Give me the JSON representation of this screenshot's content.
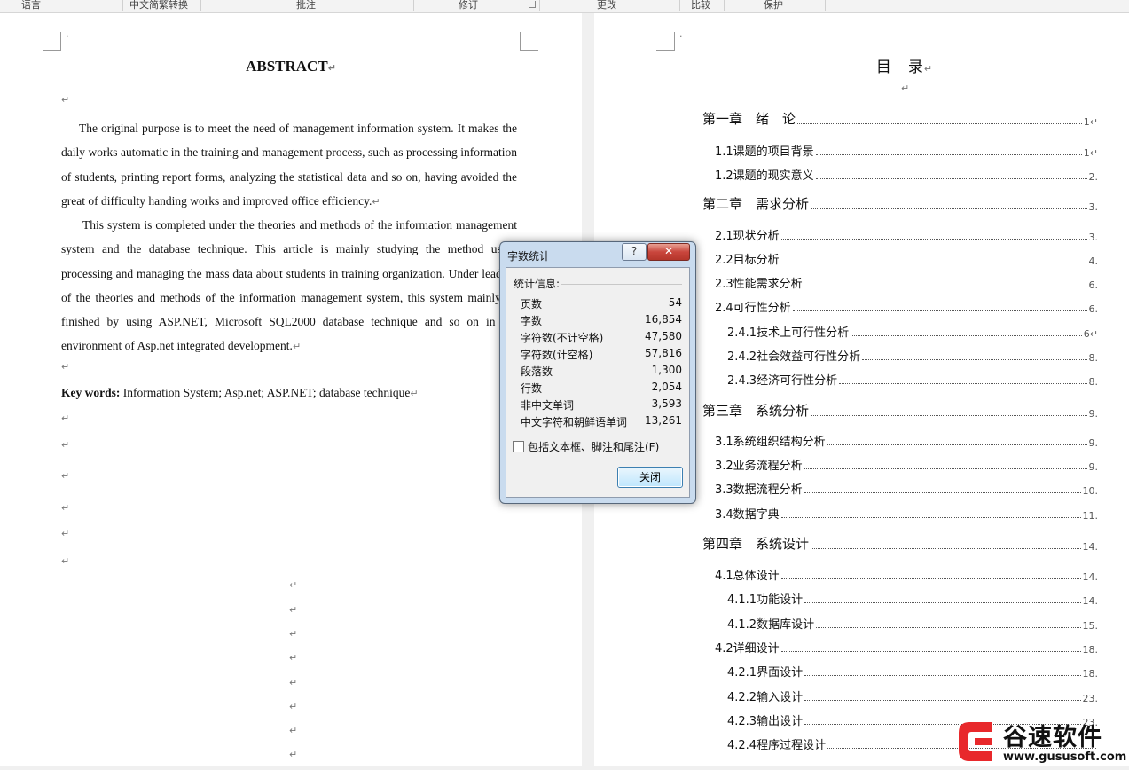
{
  "ribbon": {
    "groups": [
      "语言",
      "中文简繁转换",
      "批注",
      "修订",
      "更改",
      "比较",
      "保护"
    ]
  },
  "left_page": {
    "title": "ABSTRACT",
    "para1": "The original purpose is to meet the need of management information system. It makes the daily works automatic in the training and management process, such as processing information of students, printing report forms, analyzing the statistical data and so on, having avoided the great of difficulty handing works and improved office efficiency.",
    "para2": "This system is completed under the theories and methods of the information management system and the database technique. This article is mainly studying the method using processing and managing the mass data about students in training organization. Under leading of the theories and methods of the information management system, this system mainly be finished by using ASP.NET, Microsoft SQL2000 database technique and so on in the environment of Asp.net integrated development.",
    "keywords_label": "Key words:",
    "keywords_text": " Information System; Asp.net; ASP.NET; database technique",
    "para_mark": "↵",
    "top_mark": "·"
  },
  "right_page": {
    "title": "目　录",
    "para_mark": "↵",
    "top_mark": "·",
    "toc": [
      {
        "label": "第一章　绪　论",
        "page": "1↵"
      },
      {
        "label": "1.1课题的项目背景",
        "page": "1↵"
      },
      {
        "label": "1.2课题的现实意义",
        "page": "2."
      },
      {
        "label": "第二章　需求分析",
        "page": "3."
      },
      {
        "label": "2.1现状分析",
        "page": "3."
      },
      {
        "label": "2.2目标分析",
        "page": "4."
      },
      {
        "label": "2.3性能需求分析",
        "page": "6."
      },
      {
        "label": "2.4可行性分析",
        "page": "6."
      },
      {
        "label": "2.4.1技术上可行性分析",
        "page": "6↵"
      },
      {
        "label": "2.4.2社会效益可行性分析",
        "page": "8."
      },
      {
        "label": "2.4.3经济可行性分析",
        "page": "8."
      },
      {
        "label": "第三章　系统分析",
        "page": "9."
      },
      {
        "label": "3.1系统组织结构分析",
        "page": "9."
      },
      {
        "label": "3.2业务流程分析",
        "page": "9."
      },
      {
        "label": "3.3数据流程分析",
        "page": "10."
      },
      {
        "label": "3.4数据字典",
        "page": "11."
      },
      {
        "label": "第四章　系统设计",
        "page": "14."
      },
      {
        "label": "4.1总体设计",
        "page": "14."
      },
      {
        "label": "4.1.1功能设计",
        "page": "14."
      },
      {
        "label": "4.1.2数据库设计",
        "page": "15."
      },
      {
        "label": "4.2详细设计",
        "page": "18."
      },
      {
        "label": "4.2.1界面设计",
        "page": "18."
      },
      {
        "label": "4.2.2输入设计",
        "page": "23."
      },
      {
        "label": "4.2.3输出设计",
        "page": "23."
      },
      {
        "label": "4.2.4程序过程设计",
        "page": ""
      }
    ]
  },
  "dialog": {
    "title": "字数统计",
    "help": "?",
    "section": "统计信息:",
    "stats": [
      {
        "label": "页数",
        "value": "54"
      },
      {
        "label": "字数",
        "value": "16,854"
      },
      {
        "label": "字符数(不计空格)",
        "value": "47,580"
      },
      {
        "label": "字符数(计空格)",
        "value": "57,816"
      },
      {
        "label": "段落数",
        "value": "1,300"
      },
      {
        "label": "行数",
        "value": "2,054"
      },
      {
        "label": "非中文单词",
        "value": "3,593"
      },
      {
        "label": "中文字符和朝鲜语单词",
        "value": "13,261"
      }
    ],
    "checkbox_label": "包括文本框、脚注和尾注(F)",
    "close_label": "关闭"
  },
  "watermark": {
    "name": "谷速软件",
    "url": "www.gususoft.com"
  },
  "colors": {
    "watermark_red": "#e8282b",
    "dialog_frame": "#c9dbee",
    "close_red": "#c9463d"
  }
}
